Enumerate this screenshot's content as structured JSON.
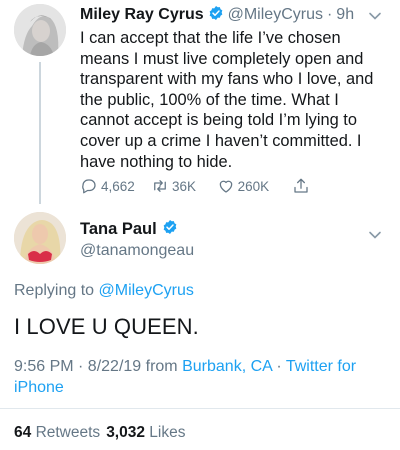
{
  "colors": {
    "accent": "#1da1f2",
    "text": "#14171a",
    "muted": "#657786",
    "divider": "#e1e8ed"
  },
  "parent_tweet": {
    "name": "Miley Ray Cyrus",
    "handle": "@MileyCyrus",
    "separator": "·",
    "time": "9h",
    "text": "I can accept that the life I’ve chosen means I must live completely open and transparent with my fans who I love, and the public, 100% of the time. What I cannot accept is being told I’m lying to cover up a crime I haven’t committed. I have nothing to hide.",
    "actions": {
      "replies": "4,662",
      "retweets": "36K",
      "likes": "260K"
    },
    "icons": [
      "verified-badge-icon",
      "chevron-down-icon",
      "reply-icon",
      "retweet-icon",
      "like-icon",
      "share-icon"
    ]
  },
  "main_tweet": {
    "name": "Tana Paul",
    "handle": "@tanamongeau",
    "replying_prefix": "Replying to",
    "replying_to": "@MileyCyrus",
    "text": "I LOVE U QUEEN.",
    "time_date": "9:56 PM · 8/22/19 from",
    "location": "Burbank, CA",
    "separator": "·",
    "source_line1": "Twitter for",
    "source_line2": "iPhone",
    "retweets_count": "64",
    "retweets_label": "Retweets",
    "likes_count": "3,032",
    "likes_label": "Likes",
    "icons": [
      "verified-badge-icon",
      "chevron-down-icon"
    ]
  }
}
